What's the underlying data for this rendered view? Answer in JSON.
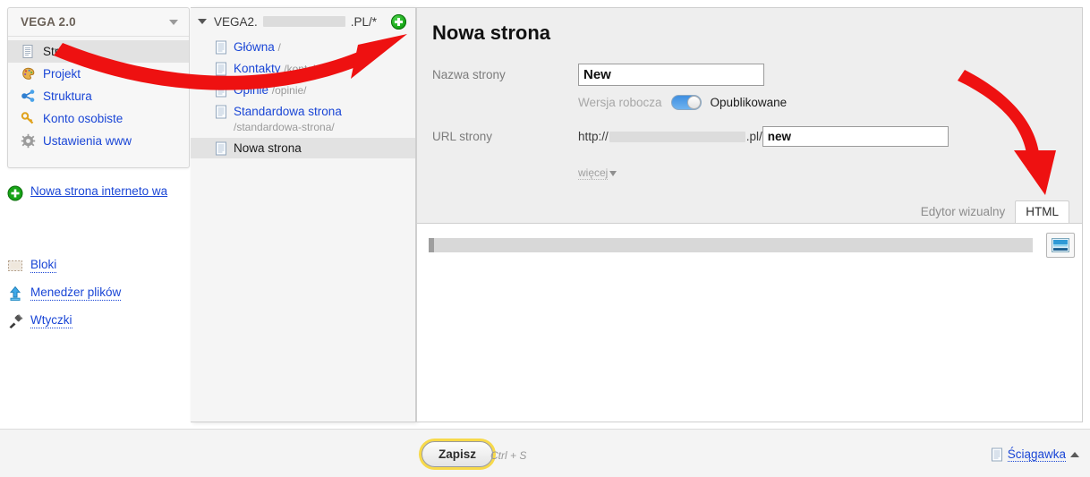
{
  "sidebar": {
    "brand": "VEGA 2.0",
    "menu": [
      {
        "label": "Strony",
        "icon": "document-icon",
        "active": true
      },
      {
        "label": "Projekt",
        "icon": "palette-icon",
        "active": false
      },
      {
        "label": "Struktura",
        "icon": "sitemap-icon",
        "active": false
      },
      {
        "label": "Konto osobiste",
        "icon": "key-icon",
        "active": false
      },
      {
        "label": "Ustawienia www",
        "icon": "gear-icon",
        "active": false
      }
    ],
    "new_site_link": "Nowa strona interneto wa",
    "links": [
      {
        "label": "Bloki",
        "icon": "blocks-icon"
      },
      {
        "label": "Menedżer plików",
        "icon": "upload-icon"
      },
      {
        "label": "Wtyczki",
        "icon": "plug-icon"
      }
    ]
  },
  "tree": {
    "root_prefix": "VEGA2.",
    "root_suffix": ".PL/*",
    "add_page_tooltip": "+",
    "pages": [
      {
        "name": "Główna",
        "slug": "/",
        "selected": false
      },
      {
        "name": "Kontakty",
        "slug": "/kontakty/",
        "selected": false
      },
      {
        "name": "Opinie",
        "slug": "/opinie/",
        "selected": false
      },
      {
        "name": "Standardowa strona",
        "slug": "/standardowa-strona/",
        "selected": false
      },
      {
        "name": "Nowa strona",
        "slug": "",
        "selected": true
      }
    ]
  },
  "main": {
    "title": "Nowa strona",
    "fields": {
      "name_label": "Nazwa strony",
      "name_value": "New",
      "draft_label": "Wersja robocza",
      "published_label": "Opublikowane",
      "published_on": true,
      "url_label": "URL strony",
      "url_prefix": "http://",
      "url_domain_suffix": ".pl/",
      "url_value": "new",
      "more_label": "więcej"
    },
    "tabs": [
      {
        "label": "Edytor wizualny",
        "active": false
      },
      {
        "label": "HTML",
        "active": true
      }
    ],
    "editor": {
      "insert_image_icon": "image-icon"
    }
  },
  "footer": {
    "save_label": "Zapisz",
    "save_shortcut": "Ctrl + S",
    "cheatsheet_label": "Ściągawka",
    "cheatsheet_icon": "document-icon"
  },
  "colors": {
    "link": "#1a46d6",
    "accent_yellow": "#f7d94a",
    "toggle_on": "#4f9ae4",
    "annotation_red": "#ee1111",
    "add_green": "#13a313"
  }
}
